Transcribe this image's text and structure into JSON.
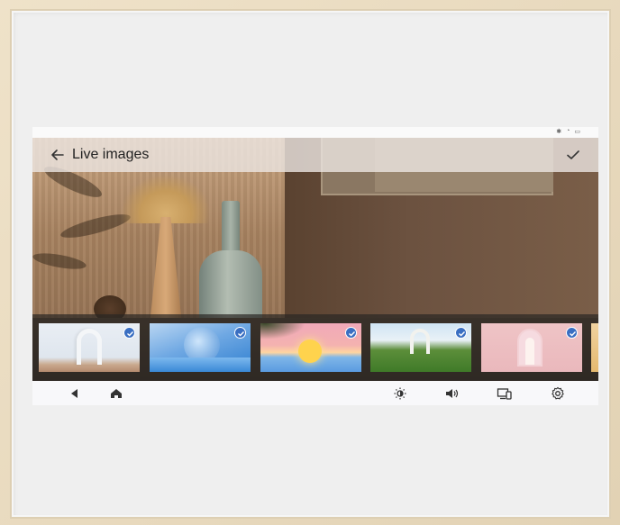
{
  "header": {
    "title": "Live images",
    "back_icon": "arrow-left-icon",
    "confirm_icon": "check-icon"
  },
  "statusbar": {
    "icons": [
      "bluetooth-icon",
      "wifi-icon",
      "battery-icon"
    ]
  },
  "thumbnails": [
    {
      "name": "white-arch",
      "selected": true
    },
    {
      "name": "blue-circle-water",
      "selected": true
    },
    {
      "name": "pink-sunset-sea",
      "selected": true
    },
    {
      "name": "green-field-arch",
      "selected": true
    },
    {
      "name": "pink-door-room",
      "selected": true
    },
    {
      "name": "partial-orange",
      "selected": false
    }
  ],
  "navbar": {
    "left": [
      "back-triangle-icon",
      "home-icon"
    ],
    "right": [
      "brightness-icon",
      "volume-icon",
      "devices-icon",
      "settings-icon"
    ]
  },
  "colors": {
    "check_badge": "#3a6fc2",
    "header_bg": "#ece6e2",
    "navbar_bg": "#f8f8fa"
  }
}
